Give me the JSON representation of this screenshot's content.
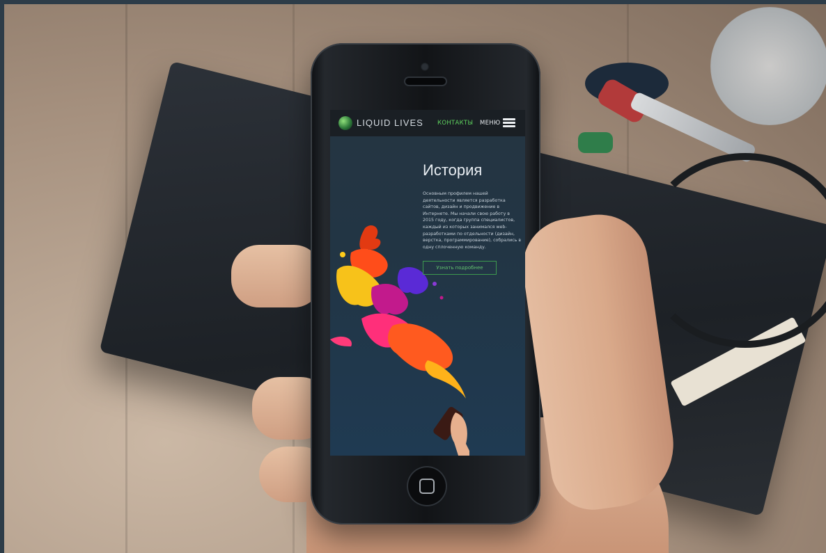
{
  "site": {
    "logo_text": "LIQUID LIVES",
    "nav": {
      "contacts_label": "КОНТАКТЫ",
      "menu_label": "МЕНЮ"
    },
    "page": {
      "title": "История",
      "description": "Основным профилем нашей деятельности является разработка сайтов, дизайн и продвижение в Интернете. Мы начали свою работу в 2015 году, когда группа специалистов, каждый из которых занимался web-разработками по отдельности (дизайн, верстка, программирование), собрались в одну сплоченную команду.",
      "cta_label": "Узнать подробнее"
    }
  },
  "colors": {
    "accent_green": "#5fd35f",
    "screen_bg": "#223544",
    "navbar_bg": "#1a1f24"
  },
  "icons": {
    "menu": "hamburger-icon",
    "logo": "globe-logo-icon",
    "home": "home-button-icon"
  }
}
